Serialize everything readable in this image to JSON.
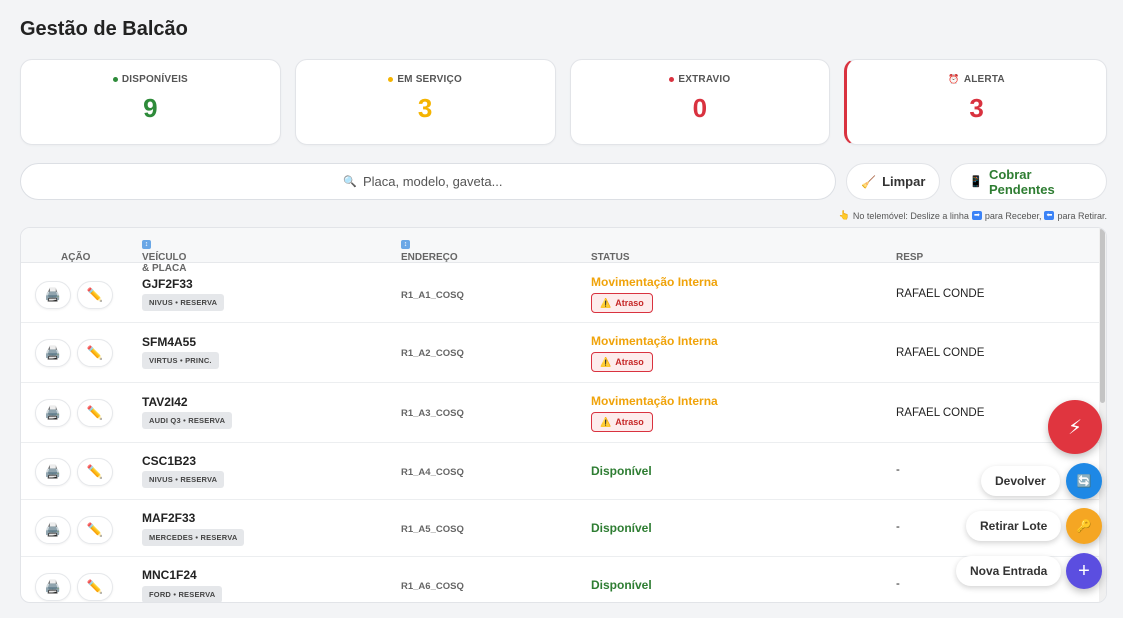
{
  "page": {
    "title": "Gestão de Balcão"
  },
  "cards": [
    {
      "label": "DISPONÍVEIS",
      "value": "9",
      "color": "#2e8b3a",
      "icon": "dot"
    },
    {
      "label": "EM SERVIÇO",
      "value": "3",
      "color": "#f5b400",
      "icon": "dot"
    },
    {
      "label": "EXTRAVIO",
      "value": "0",
      "color": "#d9323f",
      "icon": "dot"
    },
    {
      "label": "ALERTA",
      "value": "3",
      "color": "#d9323f",
      "icon": "alarm-icon"
    }
  ],
  "search": {
    "placeholder": "Placa, modelo, gaveta...",
    "icon": "🔍"
  },
  "actions": {
    "clear_label": "Limpar",
    "clear_icon": "🧹",
    "charge_label": "Cobrar Pendentes",
    "charge_icon": "📱"
  },
  "hint": {
    "icon": "👆",
    "text_1": "No telemóvel: Deslize a linha",
    "text_2": "para Receber,",
    "text_3": "para Retirar."
  },
  "table": {
    "headers": {
      "action": "AÇÃO",
      "vehicle": "VEÍCULO & PLACA",
      "address": "ENDEREÇO",
      "status": "STATUS",
      "resp": "RESP"
    },
    "late_label": "Atraso",
    "rows": [
      {
        "plate": "GJF2F33",
        "chip": "NIVUS • RESERVA",
        "address": "R1_A1_COSQ",
        "status": "Movimentação Interna",
        "late": true,
        "resp": "RAFAEL CONDE"
      },
      {
        "plate": "SFM4A55",
        "chip": "VIRTUS • PRINC.",
        "address": "R1_A2_COSQ",
        "status": "Movimentação Interna",
        "late": true,
        "resp": "RAFAEL CONDE"
      },
      {
        "plate": "TAV2I42",
        "chip": "AUDI Q3 • RESERVA",
        "address": "R1_A3_COSQ",
        "status": "Movimentação Interna",
        "late": true,
        "resp": "RAFAEL CONDE"
      },
      {
        "plate": "CSC1B23",
        "chip": "NIVUS • RESERVA",
        "address": "R1_A4_COSQ",
        "status": "Disponível",
        "late": false,
        "resp": "-"
      },
      {
        "plate": "MAF2F33",
        "chip": "MERCEDES • RESERVA",
        "address": "R1_A5_COSQ",
        "status": "Disponível",
        "late": false,
        "resp": "-"
      },
      {
        "plate": "MNC1F24",
        "chip": "FORD • RESERVA",
        "address": "R1_A6_COSQ",
        "status": "Disponível",
        "late": false,
        "resp": "-"
      }
    ]
  },
  "fab": {
    "main_icon": "⚡",
    "return_label": "Devolver",
    "return_color": "#1e88e5",
    "return_icon": "🔄",
    "batch_label": "Retirar Lote",
    "batch_color": "#f5a623",
    "batch_icon": "🔑",
    "new_label": "Nova Entrada",
    "new_color": "#5b4ee0",
    "new_icon": "+"
  }
}
